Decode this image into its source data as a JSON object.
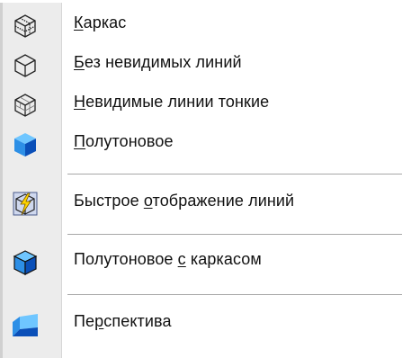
{
  "menu": {
    "items": [
      {
        "prefix": "",
        "mnemonic": "К",
        "rest": "аркас",
        "icon": "wireframe-cube-icon"
      },
      {
        "prefix": "",
        "mnemonic": "Б",
        "rest": "ез невидимых линий",
        "icon": "hidden-lines-removed-cube-icon"
      },
      {
        "prefix": "",
        "mnemonic": "Н",
        "rest": "евидимые линии тонкие",
        "icon": "thin-hidden-lines-cube-icon"
      },
      {
        "prefix": "",
        "mnemonic": "П",
        "rest": "олутоновое",
        "icon": "shaded-cube-icon"
      },
      {
        "prefix": "Быстрое ",
        "mnemonic": "о",
        "rest": "тображение линий",
        "icon": "fast-line-display-icon"
      },
      {
        "prefix": "Полутоновое ",
        "mnemonic": "с",
        "rest": " каркасом",
        "icon": "shaded-wireframe-cube-icon"
      },
      {
        "prefix": "Пе",
        "mnemonic": "р",
        "rest": "спектива",
        "icon": "perspective-icon"
      }
    ]
  },
  "colors": {
    "gutter": "#ececec",
    "shade_light": "#3aa0f0",
    "shade_dark": "#0a4fb8",
    "separator": "#a8a8a8"
  }
}
